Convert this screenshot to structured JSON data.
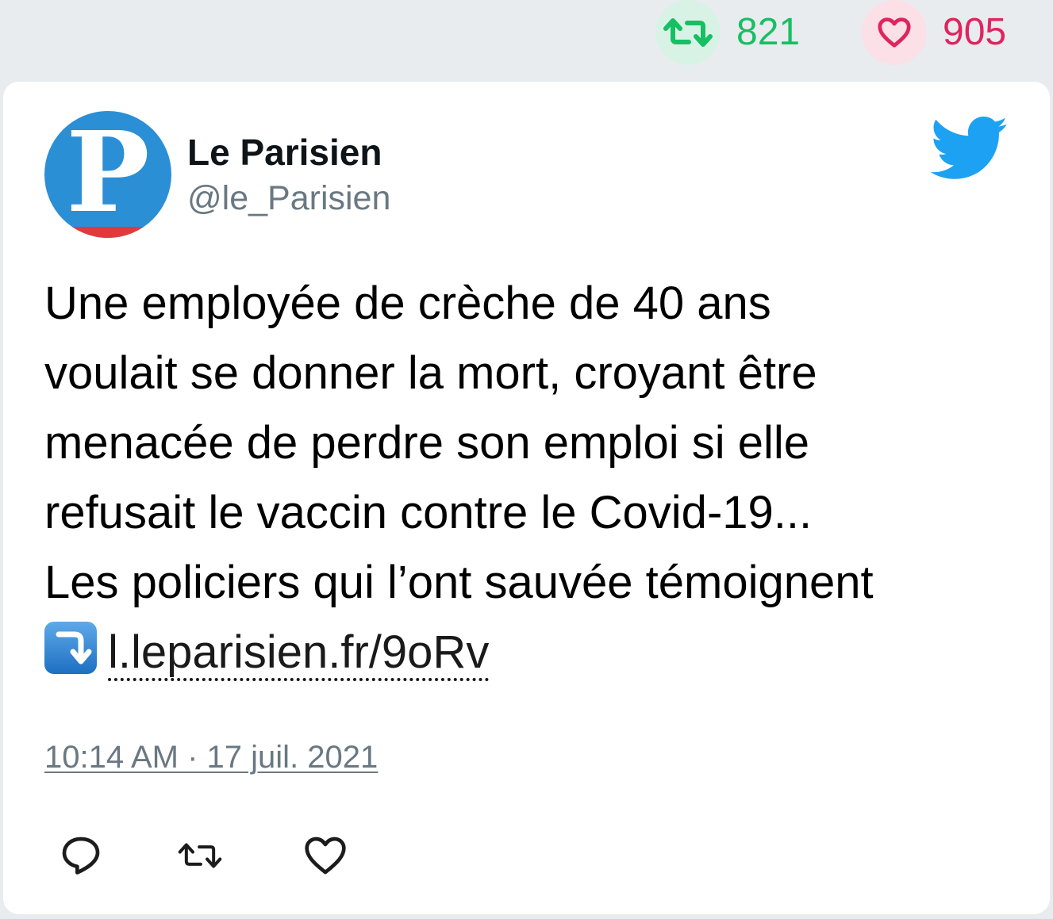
{
  "stats": {
    "retweets": "821",
    "likes": "905"
  },
  "tweet": {
    "avatar_letter": "P",
    "author_name": "Le Parisien",
    "handle": "@le_Parisien",
    "text_lines": [
      "Une employée de crèche de 40 ans",
      "voulait se donner la mort, croyant être",
      "menacée de perdre son emploi si elle",
      "refusait le vaccin contre le Covid-19...",
      "Les policiers qui l’ont sauvée témoignent"
    ],
    "link_text": "l.leparisien.fr/9oRv",
    "timestamp": "10:14 AM · 17 juil. 2021"
  },
  "icons": {
    "retweet": "retweet-icon",
    "like": "heart-icon",
    "reply": "reply-icon",
    "twitter": "twitter-bird-icon",
    "emoji": "arrow-down-right-emoji"
  },
  "colors": {
    "retweet": "#17bf63",
    "like": "#e0245e",
    "twitter_blue": "#1da1f2",
    "muted": "#697882"
  }
}
